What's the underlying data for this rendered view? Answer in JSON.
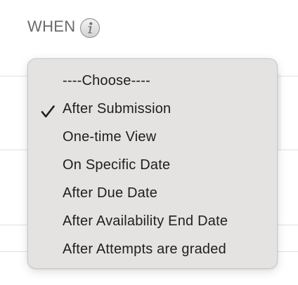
{
  "field": {
    "label": "WHEN",
    "info_icon": "info-icon"
  },
  "dropdown": {
    "options": [
      {
        "label": "----Choose----",
        "selected": false
      },
      {
        "label": "After Submission",
        "selected": true
      },
      {
        "label": "One-time View",
        "selected": false
      },
      {
        "label": "On Specific Date",
        "selected": false
      },
      {
        "label": "After Due Date",
        "selected": false
      },
      {
        "label": "After Availability End Date",
        "selected": false
      },
      {
        "label": "After Attempts are graded",
        "selected": false
      }
    ],
    "check_icon": "checkmark-icon"
  },
  "colors": {
    "menu_background": "#e4e3e2",
    "label_text": "#6b6b6b",
    "item_text": "#1e1e1e"
  }
}
